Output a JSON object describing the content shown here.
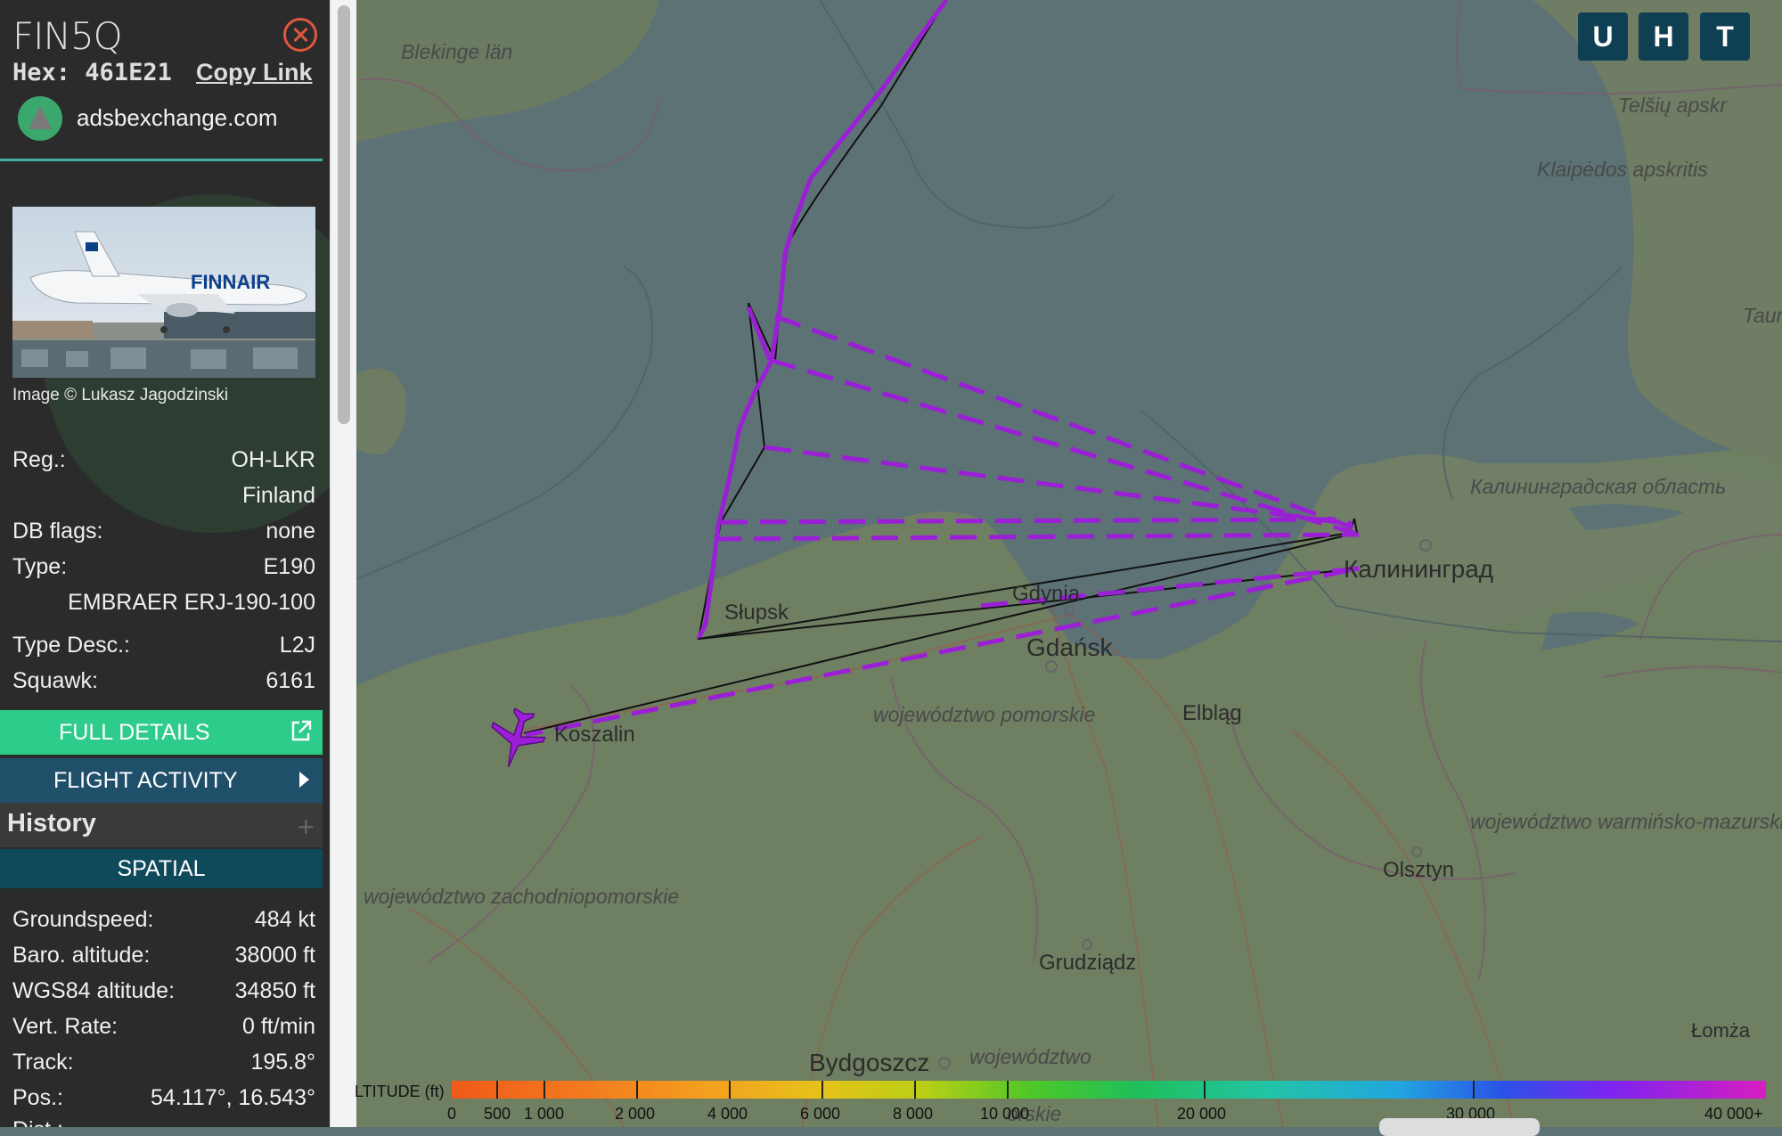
{
  "aircraft": {
    "callsign": "FIN5Q",
    "hex_label": "Hex:",
    "hex_value": "461E21",
    "copy_link": "Copy Link",
    "source": "adsbexchange.com",
    "photo_credit": "Image © Lukasz Jagodzinski"
  },
  "details": [
    {
      "label": "Reg.:",
      "value": "OH-LKR"
    },
    {
      "label": "",
      "value": "Finland"
    },
    {
      "label": "DB flags:",
      "value": "none"
    },
    {
      "label": "Type:",
      "value": "E190"
    },
    {
      "label": "",
      "value": "EMBRAER ERJ-190-100"
    },
    {
      "label": "Type Desc.:",
      "value": "L2J"
    },
    {
      "label": "Squawk:",
      "value": "6161"
    }
  ],
  "buttons": {
    "full_details": "FULL DETAILS",
    "flight_activity": "FLIGHT ACTIVITY",
    "history": "History",
    "spatial": "SPATIAL"
  },
  "spatial": [
    {
      "label": "Groundspeed:",
      "value": "484 kt"
    },
    {
      "label": "Baro. altitude:",
      "value": "38000 ft"
    },
    {
      "label": "WGS84 altitude:",
      "value": "34850 ft"
    },
    {
      "label": "Vert. Rate:",
      "value": "0 ft/min"
    },
    {
      "label": "Track:",
      "value": "195.8°"
    },
    {
      "label": "Pos.:",
      "value": "54.117°, 16.543°"
    },
    {
      "label": "Dist.:",
      "value": ""
    }
  ],
  "map_buttons": [
    "U",
    "H",
    "T"
  ],
  "map_labels": {
    "blekinge": "Blekinge län",
    "telsiu": "Telšių apskr",
    "klaipedos": "Klaipėdos apskritis",
    "taur": "Taur aps",
    "kaliningrad_obl": "Калининградская область",
    "kaliningrad": "Калининград",
    "gdynia": "Gdynia",
    "gdansk": "Gdańsk",
    "slupsk": "Słupsk",
    "koszalin": "Koszalin",
    "elblag": "Elbląg",
    "pomorskie": "województwo pomorskie",
    "warminsko": "województwo warmińsko-mazurskie",
    "olsztyn": "Olsztyn",
    "zachodnio": "województwo zachodniopomorskie",
    "grudziadz": "Grudziądz",
    "bydgoszcz": "Bydgoszcz",
    "wojewodztwo_bottom": "województwo",
    "orskie": "orskie",
    "lomza": "Łomża"
  },
  "legend": {
    "title": "LTITUDE (ft)",
    "ticks": [
      "0",
      "500",
      "1 000",
      "2 000",
      "4 000",
      "6 000",
      "8 000",
      "10 000",
      "20 000",
      "30 000",
      "40 000+"
    ]
  },
  "colors": {
    "track": "#9b1fd6",
    "accent_green": "#2ecc8a",
    "button_dark": "#0f3f52"
  }
}
